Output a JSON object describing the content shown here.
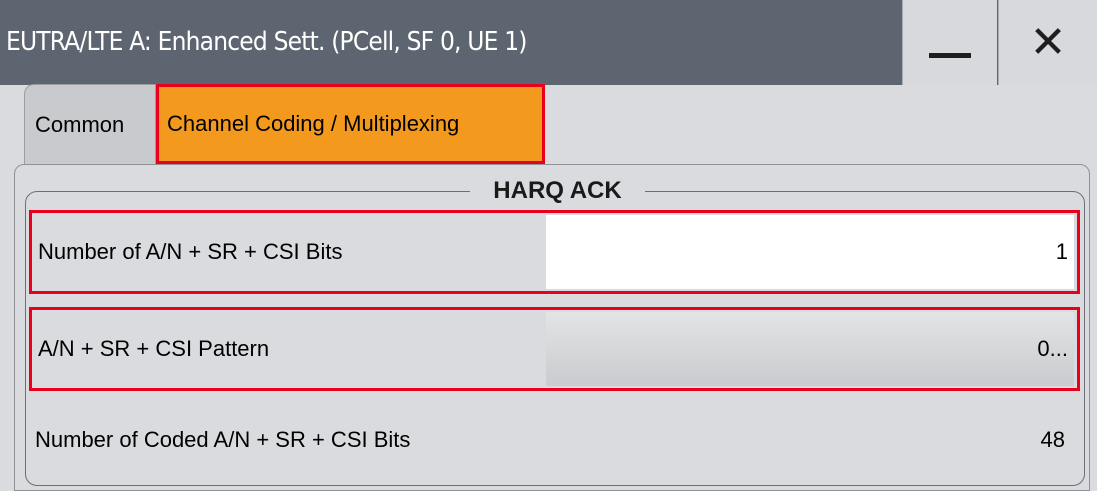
{
  "window": {
    "title": "EUTRA/LTE A: Enhanced Sett. (PCell, SF 0, UE 1)",
    "minimize_icon": "minimize-icon",
    "close_icon": "close-icon",
    "close_glyph": "✕"
  },
  "tabs": [
    {
      "label": "Common",
      "active": false
    },
    {
      "label": "Channel Coding / Multiplexing",
      "active": true
    }
  ],
  "group": {
    "title": "HARQ ACK"
  },
  "rows": [
    {
      "label": "Number of A/N + SR + CSI Bits",
      "value": "1"
    },
    {
      "label": "A/N + SR + CSI Pattern",
      "value": "0..."
    },
    {
      "label": "Number of Coded A/N + SR + CSI Bits",
      "value": "48"
    }
  ],
  "colors": {
    "titlebar": "#5d6670",
    "active_tab": "#f39a1e",
    "highlight_border": "#e8001c",
    "panel": "#d9dbde"
  }
}
